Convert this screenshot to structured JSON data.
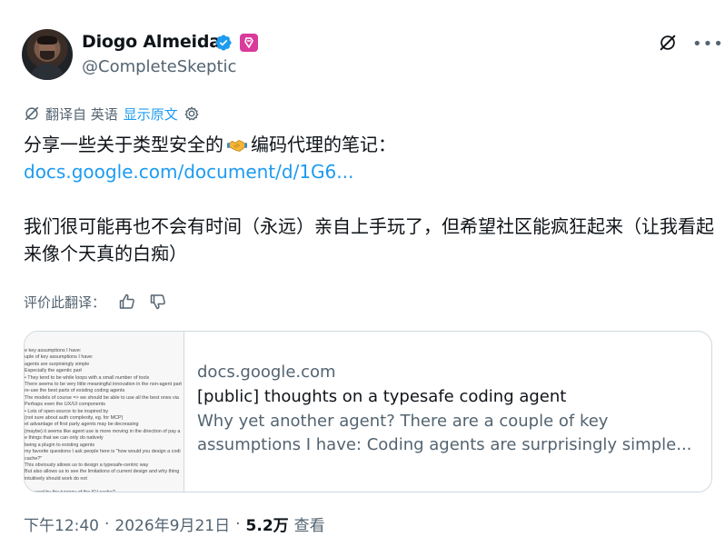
{
  "author": {
    "name": "Diogo Almeida",
    "handle": "@CompleteSkeptic"
  },
  "translation_bar": {
    "translated_from": "翻译自 英语",
    "show_original": "显示原文"
  },
  "tweet": {
    "line1_prefix": "分享一些关于类型安全的",
    "line1_suffix": "编码代理的笔记：",
    "link": "docs.google.com/document/d/1G6...",
    "para2": "我们很可能再也不会有时间（永远）亲自上手玩了，但希望社区能疯狂起来（让我看起来像个天真的白痴）"
  },
  "rating": {
    "label": "评价此翻译："
  },
  "card": {
    "domain": "docs.google.com",
    "title": "[public] thoughts on a typesafe coding agent",
    "desc_line1": "Why yet another agent? There are a couple of key",
    "desc_line2": "assumptions I have: Coding agents are surprisingly simple..."
  },
  "thumbnail_lines": [
    "e key assumptions I have:",
    "uple of key assumptions I have:",
    "agents are surprisingly simple",
    "Especially the agentic part",
    "•  They tend to be while loops with a small number of tools",
    "There seems to be very little meaningful innovation in the non-agent part",
    "re-use the best parts of existing coding agents",
    "The models of course => we should be able to use all the best ones via",
    "Perhaps even the UX/UI components",
    "•  Lots of open-source to be inspired by",
    "(not sure about auth complexity, eg. for MCP)",
    "et advantage of first party agents may be decreasing",
    "(maybe) it seems like agent use is more moving in the direction of pay a",
    "e things that we can only do natively",
    "being a plugin to existing agents",
    "my favorite questions I ask people here is \"how would you design a codi",
    "cache?\"",
    "This obviously allows us to design a typesafe-centric way",
    "But also allows us to see the limitations of current design and why thing",
    "intuitively should work do not",
    "",
    "e caused by the tyranny of the KV cache?"
  ],
  "footer": {
    "time": "下午12:40",
    "sep1": "·",
    "date": "2026年9月21日",
    "sep2": "·",
    "views": "5.2万",
    "views_label": "查看"
  },
  "colors": {
    "link": "#1d9bf0",
    "secondary_text": "#536471",
    "verified": "#1d9bf0",
    "affiliate_badge": "#d93a9b",
    "border": "#cfd9de"
  }
}
